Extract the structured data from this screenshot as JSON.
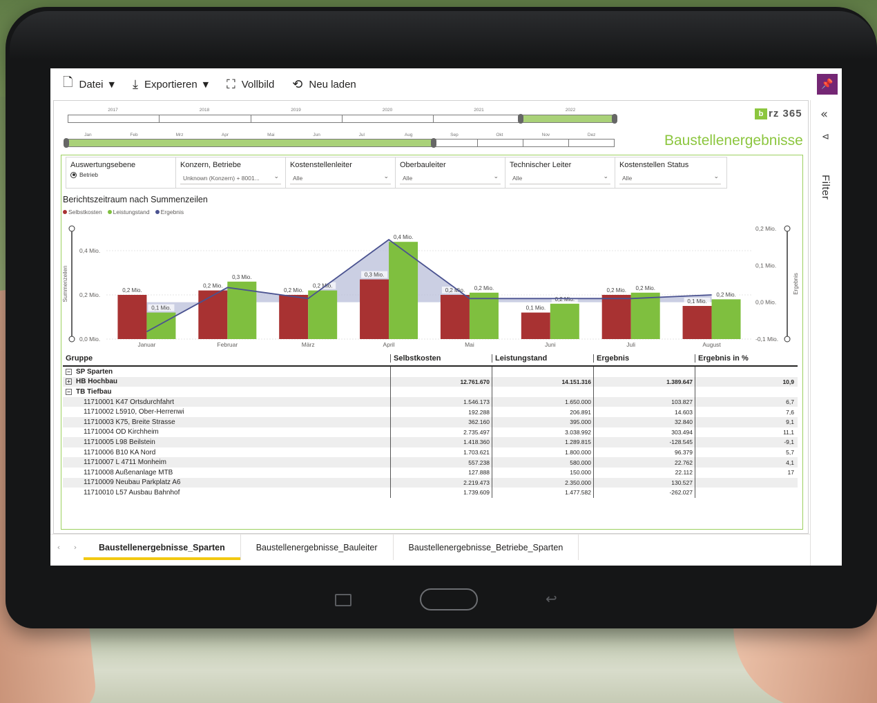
{
  "toolbar": {
    "file": "Datei",
    "export": "Exportieren",
    "fullscreen": "Vollbild",
    "reload": "Neu laden"
  },
  "filter_panel": {
    "label": "Filter"
  },
  "logo_text": "rz 365",
  "logo_mark": "b",
  "page_title": "Baustellenergebnisse",
  "timeline": {
    "years": [
      "2017",
      "2018",
      "2019",
      "2020",
      "2021",
      "2022"
    ],
    "months": [
      "Jan",
      "Feb",
      "Mrz",
      "Apr",
      "Mai",
      "Jun",
      "Jul",
      "Aug",
      "Sep",
      "Okt",
      "Nov",
      "Dez"
    ]
  },
  "slicers": [
    {
      "title": "Auswertungsebene",
      "radio": "Betrieb"
    },
    {
      "title": "Konzern, Betriebe",
      "value": "Unknown (Konzern) + 8001..."
    },
    {
      "title": "Kostenstellenleiter",
      "value": "Alle"
    },
    {
      "title": "Oberbauleiter",
      "value": "Alle"
    },
    {
      "title": "Technischer Leiter",
      "value": "Alle"
    },
    {
      "title": "Kostenstellen Status",
      "value": "Alle"
    }
  ],
  "chart_data": {
    "type": "bar",
    "title": "Berichtszeitraum nach Summenzeilen",
    "categories": [
      "Januar",
      "Februar",
      "März",
      "April",
      "Mai",
      "Juni",
      "Juli",
      "August"
    ],
    "series": [
      {
        "name": "Selbstkosten",
        "color": "#a83232",
        "values": [
          0.2,
          0.22,
          0.2,
          0.27,
          0.2,
          0.12,
          0.2,
          0.15
        ]
      },
      {
        "name": "Leistungstand",
        "color": "#7fbf3f",
        "values": [
          0.12,
          0.26,
          0.22,
          0.44,
          0.21,
          0.16,
          0.21,
          0.18
        ]
      },
      {
        "name": "Ergebnis",
        "color": "#4a5290",
        "values": [
          -0.08,
          0.04,
          0.01,
          0.17,
          0.01,
          0.01,
          0.01,
          0.02
        ]
      }
    ],
    "bar_labels": {
      "Selbstkosten": [
        "0,2 Mio.",
        "0,2 Mio.",
        "0,2 Mio.",
        "0,3 Mio.",
        "0,2 Mio.",
        "0,1 Mio.",
        "0,2 Mio.",
        "0,1 Mio."
      ],
      "Leistungstand": [
        "0,1 Mio.",
        "0,3 Mio.",
        "0,2 Mio.",
        "0,4 Mio.",
        "0,2 Mio.",
        "0,2 Mio.",
        "0,2 Mio.",
        "0,2 Mio."
      ]
    },
    "ylabel": "Summenzeilen",
    "y2label": "Ergebnis",
    "ylim": [
      0,
      0.5
    ],
    "y2lim": [
      -0.1,
      0.2
    ],
    "y_ticks": [
      "0,0 Mio.",
      "0,2 Mio.",
      "0,4 Mio."
    ],
    "y2_ticks": [
      "-0,1 Mio.",
      "0,0 Mio.",
      "0,1 Mio.",
      "0,2 Mio."
    ]
  },
  "table": {
    "headers": [
      "Gruppe",
      "Selbstkosten",
      "Leistungstand",
      "Ergebnis",
      "Ergebnis in %"
    ],
    "rows": [
      {
        "label": "SP Sparten",
        "icon": "−",
        "level": 0,
        "bold": true,
        "values": [
          "",
          "",
          "",
          ""
        ]
      },
      {
        "label": "HB Hochbau",
        "icon": "+",
        "level": 1,
        "bold": true,
        "values": [
          "12.761.670",
          "14.151.316",
          "1.389.647",
          "10,9"
        ]
      },
      {
        "label": "TB Tiefbau",
        "icon": "−",
        "level": 1,
        "bold": true,
        "values": [
          "",
          "",
          "",
          ""
        ]
      },
      {
        "label": "11710001 K47 Ortsdurchfahrt",
        "level": 2,
        "values": [
          "1.546.173",
          "1.650.000",
          "103.827",
          "6,7"
        ]
      },
      {
        "label": "11710002 L5910, Ober-Herrenwi",
        "level": 2,
        "values": [
          "192.288",
          "206.891",
          "14.603",
          "7,6"
        ]
      },
      {
        "label": "11710003 K75, Breite Strasse",
        "level": 2,
        "values": [
          "362.160",
          "395.000",
          "32.840",
          "9,1"
        ]
      },
      {
        "label": "11710004 OD Kirchheim",
        "level": 2,
        "values": [
          "2.735.497",
          "3.038.992",
          "303.494",
          "11,1"
        ]
      },
      {
        "label": "11710005 L98 Beilstein",
        "level": 2,
        "values": [
          "1.418.360",
          "1.289.815",
          "-128.545",
          "-9,1"
        ]
      },
      {
        "label": "11710006 B10 KA Nord",
        "level": 2,
        "values": [
          "1.703.621",
          "1.800.000",
          "96.379",
          "5,7"
        ]
      },
      {
        "label": "11710007 L 4711 Monheim",
        "level": 2,
        "values": [
          "557.238",
          "580.000",
          "22.762",
          "4,1"
        ]
      },
      {
        "label": "11710008 Außenanlage MTB",
        "level": 2,
        "values": [
          "127.888",
          "150.000",
          "22.112",
          "17"
        ]
      },
      {
        "label": "11710009 Neubau Parkplatz A6",
        "level": 2,
        "values": [
          "2.219.473",
          "2.350.000",
          "130.527",
          ""
        ]
      },
      {
        "label": "11710010 L57 Ausbau Bahnhof",
        "level": 2,
        "values": [
          "1.739.609",
          "1.477.582",
          "-262.027",
          ""
        ]
      }
    ]
  },
  "tabs": [
    "Baustellenergebnisse_Sparten",
    "Baustellenergebnisse_Bauleiter",
    "Baustellenergebnisse_Betriebe_Sparten"
  ],
  "active_tab": 0
}
